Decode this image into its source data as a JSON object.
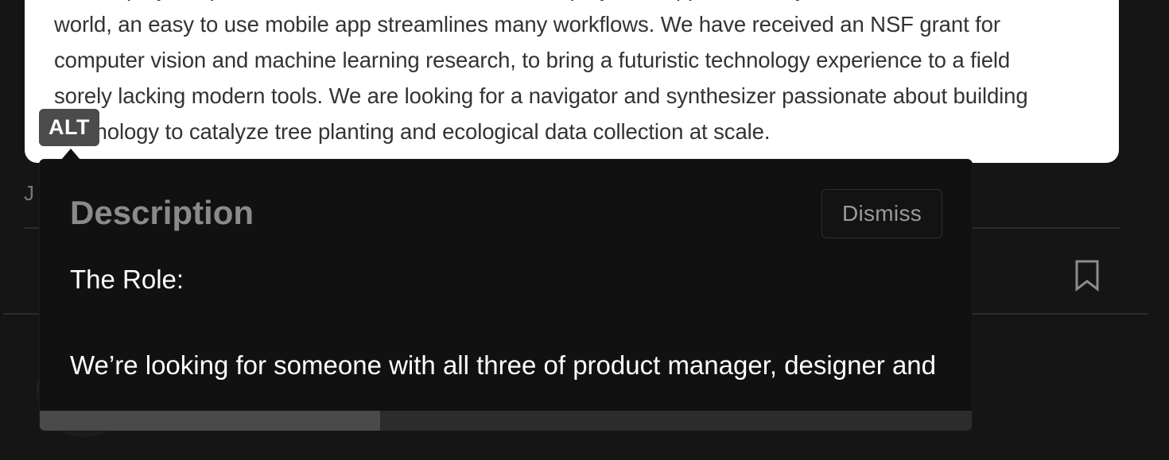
{
  "image_card": {
    "lines": [
      "carbon project operations like MRV and, since nature projects happen in many countries around the",
      "world, an easy to use mobile app streamlines many workflows. We have received an NSF grant for",
      "computer vision and machine learning research, to bring a futuristic technology experience to a field",
      "sorely lacking modern tools. We are looking for a navigator and synthesizer passionate about building",
      "technology to catalyze tree planting and ecological data collection at scale."
    ]
  },
  "alt_badge": {
    "label": "ALT"
  },
  "background": {
    "partial_letter": "J"
  },
  "popup": {
    "title": "Description",
    "dismiss_label": "Dismiss",
    "body_line_1": "The Role:",
    "body_line_2": "We’re looking for someone with all three of product manager, designer and",
    "scroll_position": 0.36
  },
  "icons": {
    "bookmark": "bookmark-icon",
    "avatar": "avatar"
  }
}
